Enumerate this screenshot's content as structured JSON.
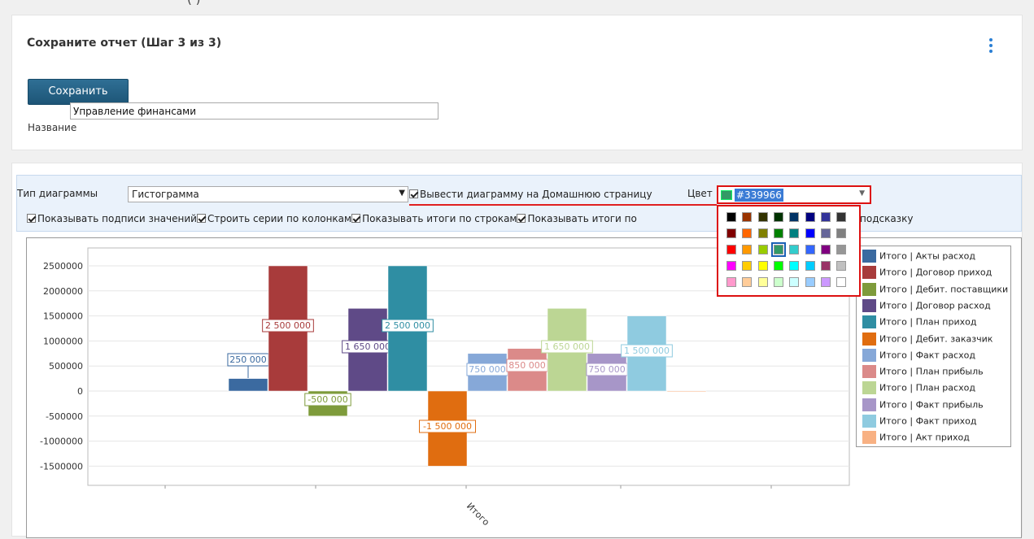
{
  "top_strip_text": "                                      (            )",
  "header": {
    "title": "Сохраните отчет (Шаг 3 из 3)",
    "save_label": "Сохранить",
    "name_label": "Название",
    "name_value": "Управление финансами"
  },
  "options": {
    "chart_type_label": "Тип диаграммы",
    "chart_type_value": "Гистограмма",
    "home_label": "Вывести диаграмму на Домашнюю страницу",
    "color_label": "Цвет",
    "color_value": "#339966",
    "row2_items": [
      "Показывать подписи значений",
      "Строить серии по колонкам",
      "Показывать итоги по строкам",
      "Показывать итоги по"
    ],
    "row2_end": "подсказку"
  },
  "colors": {
    "accent": "#2a7fd4",
    "highlight": "#d11111",
    "selected_color": "#339966"
  },
  "palette": [
    [
      "#000000",
      "#993300",
      "#333300",
      "#003300",
      "#003366",
      "#000080",
      "#333399",
      "#333333"
    ],
    [
      "#800000",
      "#FF6600",
      "#808000",
      "#008000",
      "#008080",
      "#0000FF",
      "#666699",
      "#808080"
    ],
    [
      "#FF0000",
      "#FF9900",
      "#99CC00",
      "#339966",
      "#33CCCC",
      "#3366FF",
      "#800080",
      "#969696"
    ],
    [
      "#FF00FF",
      "#FFCC00",
      "#FFFF00",
      "#00FF00",
      "#00FFFF",
      "#00CCFF",
      "#993366",
      "#C0C0C0"
    ],
    [
      "#FF99CC",
      "#FFCC99",
      "#FFFF99",
      "#CCFFCC",
      "#CCFFFF",
      "#99CCFF",
      "#CC99FF",
      "#FFFFFF"
    ]
  ],
  "chart_data": {
    "type": "bar",
    "categories": [
      "Итого"
    ],
    "ylim": [
      -1750000,
      2750000
    ],
    "yticks": [
      2500000,
      2000000,
      1500000,
      1000000,
      500000,
      0,
      -500000,
      -1000000,
      -1500000
    ],
    "ytick_labels": [
      "2500000",
      "2000000",
      "1500000",
      "1000000",
      "500000",
      "0",
      "-500000",
      "-1000000",
      "-1500000"
    ],
    "legend_position": "right",
    "series": [
      {
        "name": "Итого | Акты расход",
        "values": [
          250000
        ],
        "label": "250 000",
        "color": "#3b6aa0"
      },
      {
        "name": "Итого | Договор приход",
        "values": [
          2500000
        ],
        "label": "2 500 000",
        "color": "#a83b3b"
      },
      {
        "name": "Итого | Дебит. поставщики",
        "values": [
          -500000
        ],
        "label": "-500 000",
        "color": "#7e9b3b"
      },
      {
        "name": "Итого | Договор расход",
        "values": [
          1650000
        ],
        "label": "1 650 000",
        "color": "#5f4a87"
      },
      {
        "name": "Итого | План приход",
        "values": [
          2500000
        ],
        "label": "2 500 000",
        "color": "#2f8ea3"
      },
      {
        "name": "Итого | Дебит. заказчик",
        "values": [
          -1500000
        ],
        "label": "-1 500 000",
        "color": "#e06d10"
      },
      {
        "name": "Итого | Факт расход",
        "values": [
          750000
        ],
        "label": "750 000",
        "color": "#86a8d8"
      },
      {
        "name": "Итого | План прибыль",
        "values": [
          850000
        ],
        "label": "850 000",
        "color": "#db8a89"
      },
      {
        "name": "Итого | План расход",
        "values": [
          1650000
        ],
        "label": "1 650 000",
        "color": "#bcd694"
      },
      {
        "name": "Итого | Факт прибыль",
        "values": [
          750000
        ],
        "label": "750 000",
        "color": "#a796c8"
      },
      {
        "name": "Итого | Факт приход",
        "values": [
          1500000
        ],
        "label": "1 500 000",
        "color": "#8fcbe0"
      },
      {
        "name": "Итого | Акт приход",
        "values": [
          0
        ],
        "label": "",
        "color": "#f8b183"
      }
    ]
  }
}
